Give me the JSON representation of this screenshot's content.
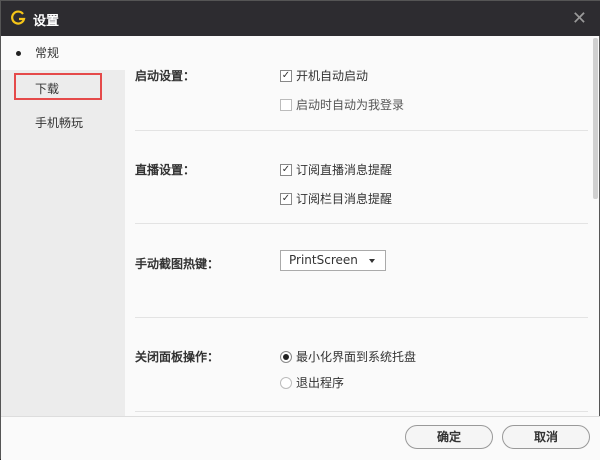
{
  "window": {
    "title": "设置"
  },
  "sidebar": {
    "items": [
      {
        "label": "常规"
      },
      {
        "label": "下载"
      },
      {
        "label": "手机畅玩"
      }
    ]
  },
  "sections": {
    "startup": {
      "label": "启动设置：",
      "options": [
        {
          "label": "开机自动启动",
          "checked": true
        },
        {
          "label": "启动时自动为我登录",
          "checked": false
        }
      ]
    },
    "live": {
      "label": "直播设置：",
      "options": [
        {
          "label": "订阅直播消息提醒",
          "checked": true
        },
        {
          "label": "订阅栏目消息提醒",
          "checked": true
        }
      ]
    },
    "hotkey": {
      "label": "手动截图热键：",
      "value": "PrintScreen"
    },
    "close": {
      "label": "关闭面板操作：",
      "options": [
        {
          "label": "最小化界面到系统托盘",
          "selected": true
        },
        {
          "label": "退出程序",
          "selected": false
        }
      ]
    }
  },
  "footer": {
    "ok": "确定",
    "cancel": "取消"
  }
}
